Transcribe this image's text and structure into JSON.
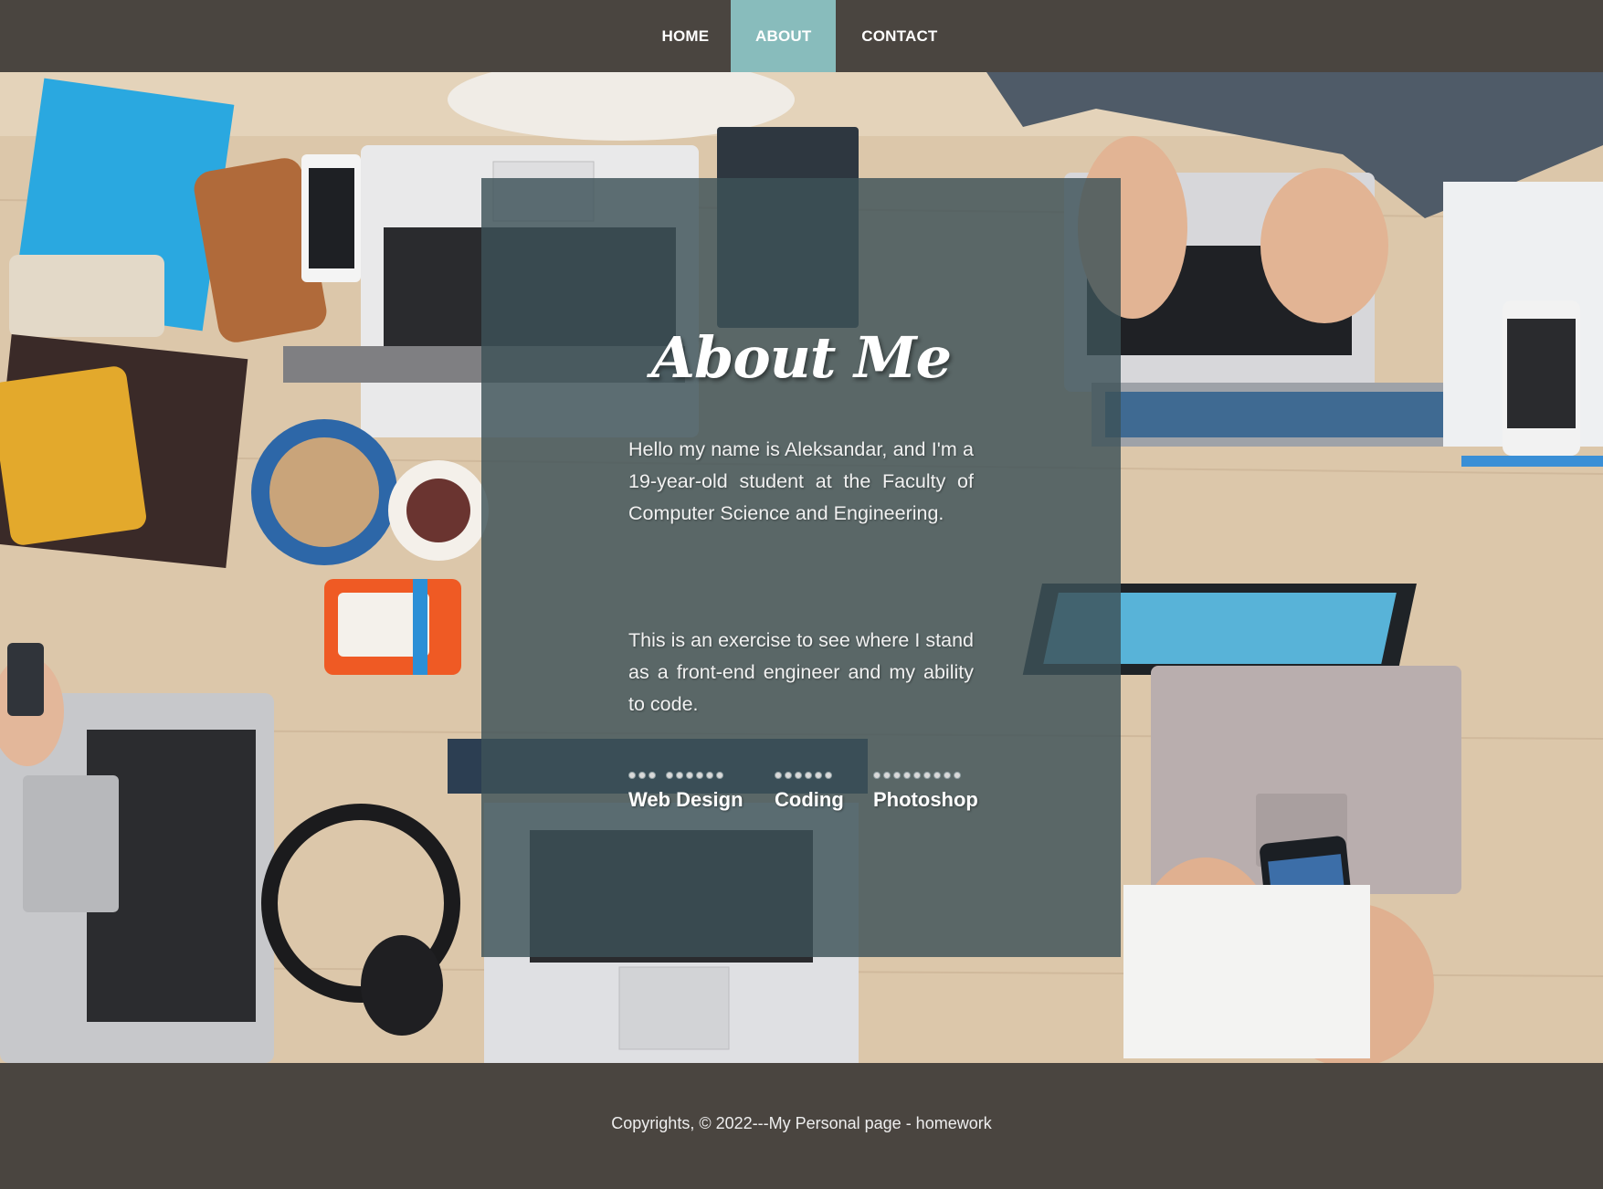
{
  "nav": {
    "items": [
      {
        "label": "HOME",
        "active": false
      },
      {
        "label": "ABOUT",
        "active": true
      },
      {
        "label": "CONTACT",
        "active": false
      }
    ]
  },
  "about": {
    "title": "About Me",
    "paragraph1": "Hello my name is Aleksandar, and I'm a 19-year-old student at the Faculty of Computer Science and Engineering.",
    "paragraph2": "This is an exercise to see where I stand as a front-end engineer and my ability to code.",
    "skills": [
      {
        "label": "Web Design",
        "level": "9 of 9 dots"
      },
      {
        "label": "Coding",
        "level": "6 of 6 dots"
      },
      {
        "label": "Photoshop",
        "level": "9 of 9 dots"
      }
    ]
  },
  "footer": {
    "text": "Copyrights, © 2022---My Personal page - homework"
  },
  "colors": {
    "nav_bg": "#4a4540",
    "nav_active": "#88bcbc",
    "overlay": "#3d5258",
    "footer_bg": "#4a4540"
  }
}
